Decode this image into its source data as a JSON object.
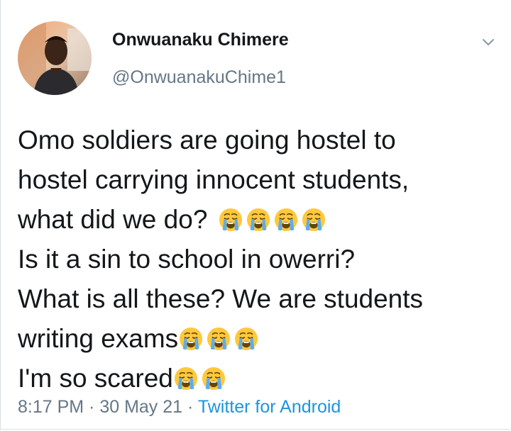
{
  "user": {
    "display_name": "Onwuanaku Chimere",
    "handle": "@OnwuanakuChime1"
  },
  "tweet": {
    "lines": [
      "Omo soldiers are going hostel to",
      "hostel carrying innocent students,",
      "what did we do? ",
      "Is it a sin to school in owerri?",
      "What is all these? We are students",
      "writing exams",
      "I'm so scared"
    ],
    "emoji": "loudly-crying-face"
  },
  "meta": {
    "time": "8:17 PM",
    "separator": " · ",
    "date": "30 May 21",
    "source": "Twitter for Android"
  },
  "colors": {
    "text": "#14171a",
    "secondary": "#657786",
    "link": "#1b95e0"
  },
  "icons": {
    "menu": "chevron-down-icon",
    "avatar": "profile-photo"
  }
}
